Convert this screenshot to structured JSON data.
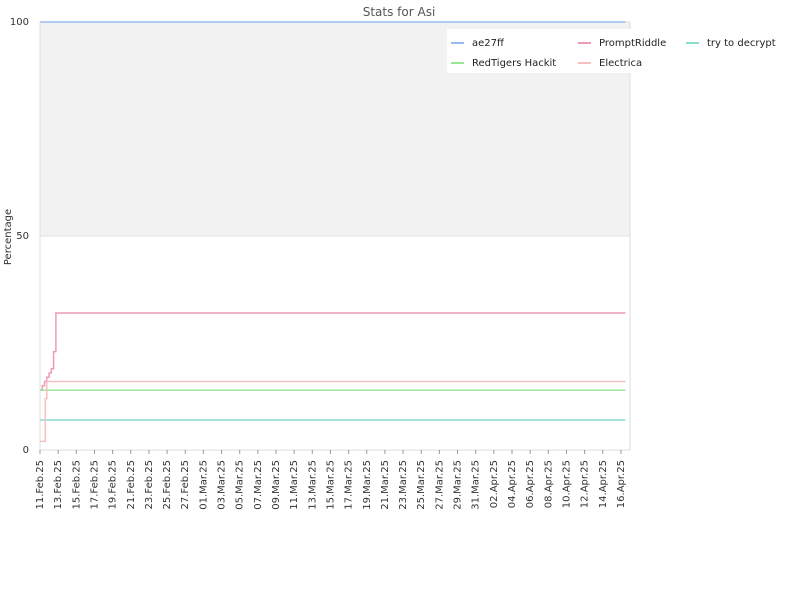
{
  "chart_data": {
    "type": "line",
    "title": "Stats for Asi",
    "xlabel": "",
    "ylabel": "Percentage",
    "ylim": [
      0,
      100
    ],
    "y_ticks": [
      0,
      50,
      100
    ],
    "x_range": [
      "2025-02-11",
      "2025-04-17"
    ],
    "x_ticks": [
      {
        "date": "2025-02-11",
        "label": "11.Feb.25"
      },
      {
        "date": "2025-02-13",
        "label": "13.Feb.25"
      },
      {
        "date": "2025-02-15",
        "label": "15.Feb.25"
      },
      {
        "date": "2025-02-17",
        "label": "17.Feb.25"
      },
      {
        "date": "2025-02-19",
        "label": "19.Feb.25"
      },
      {
        "date": "2025-02-21",
        "label": "21.Feb.25"
      },
      {
        "date": "2025-02-23",
        "label": "23.Feb.25"
      },
      {
        "date": "2025-02-25",
        "label": "25.Feb.25"
      },
      {
        "date": "2025-02-27",
        "label": "27.Feb.25"
      },
      {
        "date": "2025-03-01",
        "label": "01.Mar.25"
      },
      {
        "date": "2025-03-03",
        "label": "03.Mar.25"
      },
      {
        "date": "2025-03-05",
        "label": "05.Mar.25"
      },
      {
        "date": "2025-03-07",
        "label": "07.Mar.25"
      },
      {
        "date": "2025-03-09",
        "label": "09.Mar.25"
      },
      {
        "date": "2025-03-11",
        "label": "11.Mar.25"
      },
      {
        "date": "2025-03-13",
        "label": "13.Mar.25"
      },
      {
        "date": "2025-03-15",
        "label": "15.Mar.25"
      },
      {
        "date": "2025-03-17",
        "label": "17.Mar.25"
      },
      {
        "date": "2025-03-19",
        "label": "19.Mar.25"
      },
      {
        "date": "2025-03-21",
        "label": "21.Mar.25"
      },
      {
        "date": "2025-03-23",
        "label": "23.Mar.25"
      },
      {
        "date": "2025-03-25",
        "label": "25.Mar.25"
      },
      {
        "date": "2025-03-27",
        "label": "27.Mar.25"
      },
      {
        "date": "2025-03-29",
        "label": "29.Mar.25"
      },
      {
        "date": "2025-03-31",
        "label": "31.Mar.25"
      },
      {
        "date": "2025-04-02",
        "label": "02.Apr.25"
      },
      {
        "date": "2025-04-04",
        "label": "04.Apr.25"
      },
      {
        "date": "2025-04-06",
        "label": "06.Apr.25"
      },
      {
        "date": "2025-04-08",
        "label": "08.Apr.25"
      },
      {
        "date": "2025-04-10",
        "label": "10.Apr.25"
      },
      {
        "date": "2025-04-12",
        "label": "12.Apr.25"
      },
      {
        "date": "2025-04-14",
        "label": "14.Apr.25"
      },
      {
        "date": "2025-04-16",
        "label": "16.Apr.25"
      }
    ],
    "grid": "horizontal",
    "shaded_band": {
      "y_from": 50,
      "y_to": 100,
      "color": "#f2f2f2"
    },
    "legend_position": "top-right",
    "series": [
      {
        "name": "ae27ff",
        "color": "#99bbee",
        "points": [
          [
            "2025-02-11T00:00",
            100
          ],
          [
            "2025-04-16T12:00",
            100
          ]
        ]
      },
      {
        "name": "PromptRiddle",
        "color": "#ee99bb",
        "points": [
          [
            "2025-02-11T00:00",
            14
          ],
          [
            "2025-02-11T06:00",
            15
          ],
          [
            "2025-02-11T12:00",
            16
          ],
          [
            "2025-02-11T18:00",
            17
          ],
          [
            "2025-02-12T00:00",
            18
          ],
          [
            "2025-02-12T06:00",
            19
          ],
          [
            "2025-02-12T12:00",
            23
          ],
          [
            "2025-02-12T18:00",
            32
          ],
          [
            "2025-04-16T12:00",
            32
          ]
        ]
      },
      {
        "name": "try to decrypt",
        "color": "#88ddcc",
        "points": [
          [
            "2025-02-11T00:00",
            7
          ],
          [
            "2025-04-16T12:00",
            7
          ]
        ]
      },
      {
        "name": "RedTigers Hackit",
        "color": "#99e699",
        "points": [
          [
            "2025-02-11T00:00",
            14
          ],
          [
            "2025-04-16T12:00",
            14
          ]
        ]
      },
      {
        "name": "Electrica",
        "color": "#f5c0c0",
        "points": [
          [
            "2025-02-11T00:00",
            2
          ],
          [
            "2025-02-11T12:00",
            2
          ],
          [
            "2025-02-11T14:00",
            12
          ],
          [
            "2025-02-11T18:00",
            16
          ],
          [
            "2025-04-16T12:00",
            16
          ]
        ]
      }
    ]
  }
}
